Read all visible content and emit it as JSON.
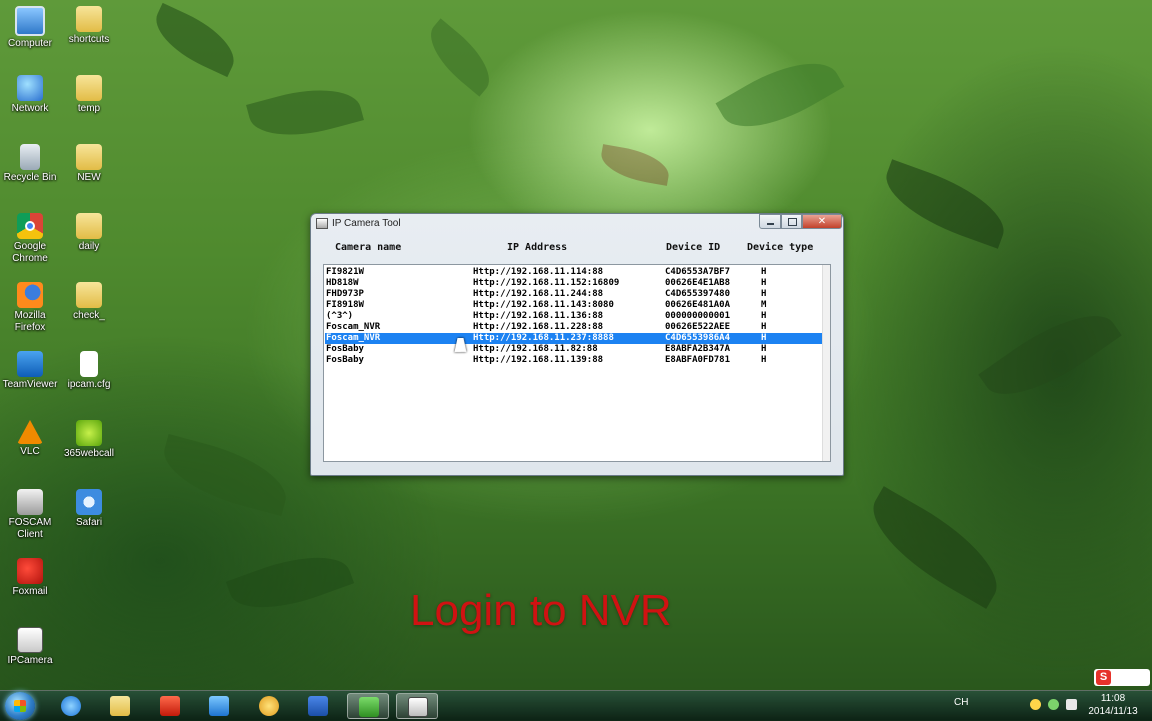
{
  "desktop": {
    "icons": [
      {
        "label": "Computer"
      },
      {
        "label": "shortcuts"
      },
      {
        "label": "Network"
      },
      {
        "label": "temp"
      },
      {
        "label": "Recycle Bin"
      },
      {
        "label": "NEW"
      },
      {
        "label": "Google Chrome"
      },
      {
        "label": "daily"
      },
      {
        "label": "Mozilla Firefox"
      },
      {
        "label": "check_"
      },
      {
        "label": "TeamViewer"
      },
      {
        "label": "ipcam.cfg"
      },
      {
        "label": "VLC"
      },
      {
        "label": "365webcall"
      },
      {
        "label": "FOSCAM Client"
      },
      {
        "label": "Safari"
      },
      {
        "label": "Foxmail"
      },
      {
        "label": "IPCamera"
      }
    ]
  },
  "window": {
    "title": "IP Camera Tool",
    "close_glyph": "✕",
    "columns": {
      "name": "Camera name",
      "ip": "IP Address",
      "id": "Device ID",
      "type": "Device type"
    },
    "rows": [
      {
        "name": "FI9821W",
        "ip": "Http://192.168.11.114:88",
        "id": "C4D6553A7BF7",
        "type": "H"
      },
      {
        "name": "HD818W",
        "ip": "Http://192.168.11.152:16809",
        "id": "00626E4E1AB8",
        "type": "H"
      },
      {
        "name": "FHD973P",
        "ip": "Http://192.168.11.244:88",
        "id": "C4D655397480",
        "type": "H"
      },
      {
        "name": "FI8918W",
        "ip": "Http://192.168.11.143:8080",
        "id": "00626E481A0A",
        "type": "M"
      },
      {
        "name": "(^3^)",
        "ip": "Http://192.168.11.136:88",
        "id": "000000000001",
        "type": "H"
      },
      {
        "name": "Foscam_NVR",
        "ip": "Http://192.168.11.228:88",
        "id": "00626E522AEE",
        "type": "H"
      },
      {
        "name": "Foscam_NVR",
        "ip": "Http://192.168.11.237:8888",
        "id": "C4D6553986A4",
        "type": "H"
      },
      {
        "name": "FosBaby",
        "ip": "Http://192.168.11.82:88",
        "id": "E8ABFA2B347A",
        "type": "H"
      },
      {
        "name": "FosBaby",
        "ip": "Http://192.168.11.139:88",
        "id": "E8ABFA0FD781",
        "type": "H"
      }
    ],
    "selected_row_index": 6
  },
  "caption": "Login to NVR",
  "taskbar": {
    "ime": "CH",
    "time": "11:08",
    "date": "2014/11/13",
    "sogou": "S"
  },
  "colors": {
    "selection": "#1c82f2",
    "caption": "#d01212"
  }
}
